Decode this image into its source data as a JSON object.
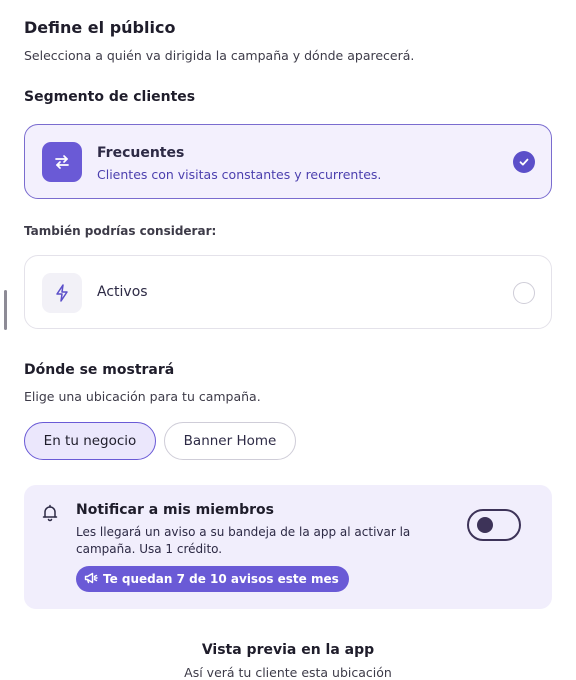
{
  "header": {
    "title": "Define el público",
    "subtitle": "Selecciona a quién va dirigida la campaña y dónde aparecerá."
  },
  "segment": {
    "heading": "Segmento de clientes",
    "selected": {
      "icon": "repeat-icon",
      "title": "Frecuentes",
      "description": "Clientes con visitas constantes y recurrentes."
    },
    "suggestion_heading": "También podrías considerar:",
    "suggestions": [
      {
        "icon": "lightning-icon",
        "title": "Activos"
      }
    ]
  },
  "placement": {
    "heading": "Dónde se mostrará",
    "subtitle": "Elige una ubicación para tu campaña.",
    "options": [
      {
        "label": "En tu negocio",
        "selected": true
      },
      {
        "label": "Banner Home",
        "selected": false
      }
    ]
  },
  "notify": {
    "icon": "bell-icon",
    "title": "Notificar a mis miembros",
    "description": "Les llegará un aviso a su bandeja de la app al activar la campaña. Usa 1 crédito.",
    "enabled": false,
    "credits_badge": "Te quedan 7 de 10 avisos este mes",
    "credits_icon": "megaphone-icon"
  },
  "preview": {
    "title": "Vista previa en la app",
    "subtitle": "Así verá tu cliente esta ubicación"
  },
  "colors": {
    "accent": "#6a5ad6",
    "accent_light": "#f3f0fd",
    "notify_bg": "#f1eefc"
  }
}
